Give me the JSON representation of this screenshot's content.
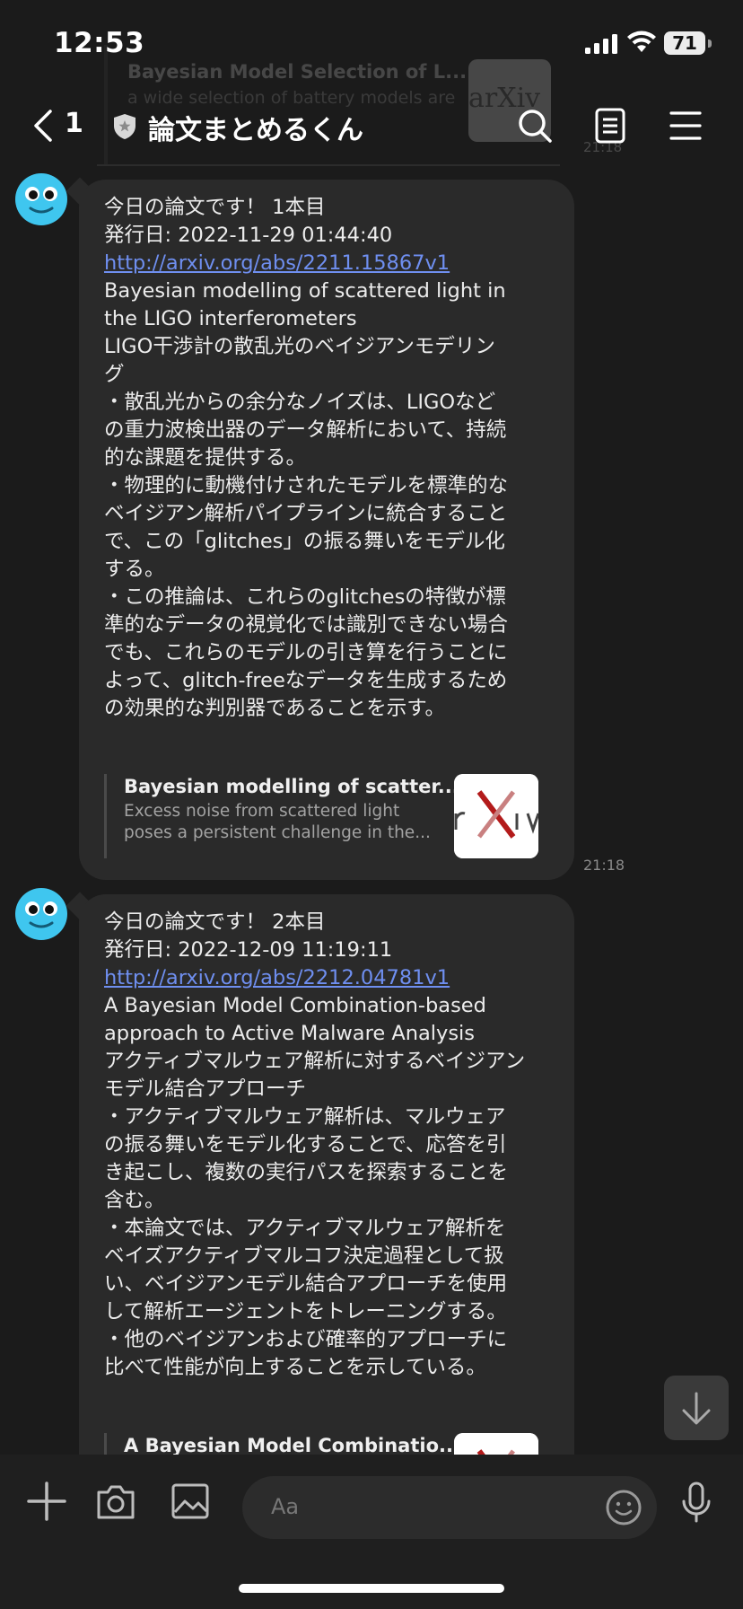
{
  "status": {
    "time": "12:53",
    "battery": "71"
  },
  "ghost_preview": {
    "title": "Bayesian Model Selection of L...",
    "desc": "a wide selection of battery models are",
    "thumb": "arXiv"
  },
  "header": {
    "back_count": "1",
    "chat_title": "論文まとめるくん"
  },
  "messages": [
    {
      "lines": [
        "今日の論文です！ 1本目",
        "発行日: 2022-11-29 01:44:40"
      ],
      "link": "http://arxiv.org/abs/2211.15867v1",
      "body": [
        "Bayesian modelling of scattered light in",
        "the LIGO interferometers",
        "LIGO干渉計の散乱光のベイジアンモデリン",
        "グ",
        "・散乱光からの余分なノイズは、LIGOなど",
        "の重力波検出器のデータ解析において、持続",
        "的な課題を提供する。",
        "・物理的に動機付けされたモデルを標準的な",
        "ベイジアン解析パイプラインに統合すること",
        "で、この「glitches」の振る舞いをモデル化",
        "する。",
        "・この推論は、これらのglitchesの特徴が標",
        "準的なデータの視覚化では識別できない場合",
        "でも、これらのモデルの引き算を行うことに",
        "よって、glitch-freeなデータを生成するため",
        "の効果的な判別器であることを示す。"
      ],
      "preview_title": "Bayesian modelling of scatter...",
      "preview_desc": [
        "Excess noise from scattered light",
        "poses a persistent challenge in the..."
      ],
      "time": "21:18"
    },
    {
      "lines": [
        "今日の論文です！ 2本目",
        "発行日: 2022-12-09 11:19:11"
      ],
      "link": "http://arxiv.org/abs/2212.04781v1",
      "body": [
        "A Bayesian Model Combination-based",
        "approach to Active Malware Analysis",
        "アクティブマルウェア解析に対するベイジアン",
        "モデル結合アプローチ",
        "・アクティブマルウェア解析は、マルウェア",
        "の振る舞いをモデル化することで、応答を引",
        "き起こし、複数の実行パスを探索することを",
        "含む。",
        "・本論文では、アクティブマルウェア解析を",
        "ベイズアクティブマルコフ決定過程として扱",
        "い、ベイジアンモデル結合アプローチを使用",
        "して解析エージェントをトレーニングする。",
        "・他のベイジアンおよび確率的アプローチに",
        "比べて性能が向上することを示している。"
      ],
      "preview_title": "A Bayesian Model Combinatio..."
    }
  ],
  "input": {
    "placeholder": "Aa"
  },
  "colors": {
    "background": "#1b1b1b",
    "bubble": "#2a2a2a",
    "link": "#6f8ff0",
    "avatar": "#3fc6ef"
  },
  "icons": [
    "back-chevron-icon",
    "shield-icon",
    "search-icon",
    "notes-icon",
    "menu-icon",
    "plus-icon",
    "camera-icon",
    "image-icon",
    "emoji-icon",
    "microphone-icon",
    "arrow-down-icon"
  ]
}
